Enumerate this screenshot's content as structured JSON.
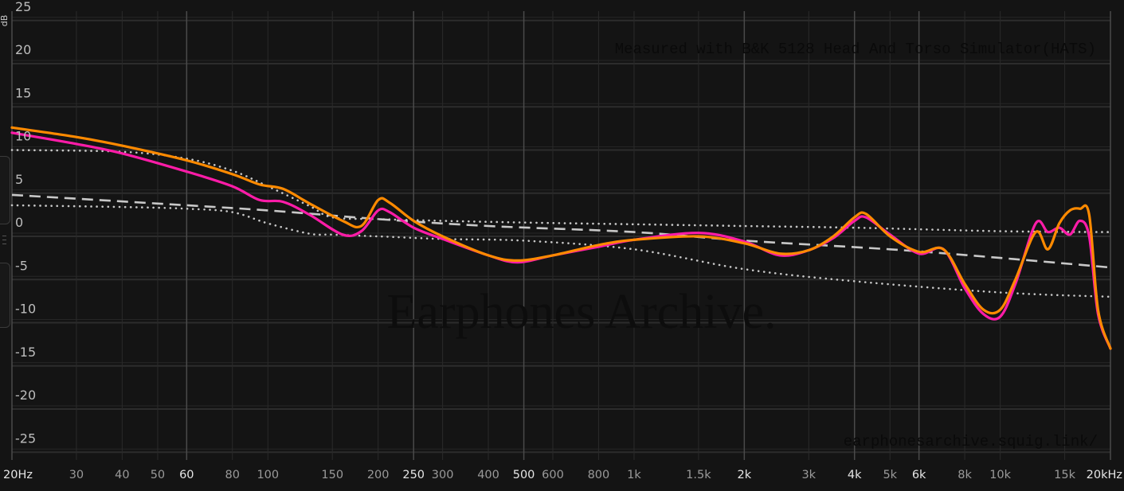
{
  "chart_data": {
    "type": "line",
    "title": "",
    "xlabel": "",
    "ylabel": "dB",
    "x_scale": "log",
    "xlim": [
      20,
      20000
    ],
    "ylim": [
      -27,
      27
    ],
    "grid": true,
    "y_ticks": [
      25,
      20,
      15,
      10,
      5,
      0,
      -5,
      -10,
      -15,
      -20,
      -25
    ],
    "y_tick_labels": [
      "25",
      "20",
      "15",
      "10",
      "5",
      "0",
      "-5",
      "-10",
      "-15",
      "-20",
      "-25"
    ],
    "x_ticks": [
      {
        "f": 20,
        "label": "20Hz",
        "major": true
      },
      {
        "f": 30,
        "label": "30",
        "major": false
      },
      {
        "f": 40,
        "label": "40",
        "major": false
      },
      {
        "f": 50,
        "label": "50",
        "major": false
      },
      {
        "f": 60,
        "label": "60",
        "major": true
      },
      {
        "f": 80,
        "label": "80",
        "major": false
      },
      {
        "f": 100,
        "label": "100",
        "major": false
      },
      {
        "f": 150,
        "label": "150",
        "major": false
      },
      {
        "f": 200,
        "label": "200",
        "major": false
      },
      {
        "f": 250,
        "label": "250",
        "major": true
      },
      {
        "f": 300,
        "label": "300",
        "major": false
      },
      {
        "f": 400,
        "label": "400",
        "major": false
      },
      {
        "f": 500,
        "label": "500",
        "major": true
      },
      {
        "f": 600,
        "label": "600",
        "major": false
      },
      {
        "f": 800,
        "label": "800",
        "major": false
      },
      {
        "f": 1000,
        "label": "1k",
        "major": false
      },
      {
        "f": 1500,
        "label": "1.5k",
        "major": false
      },
      {
        "f": 2000,
        "label": "2k",
        "major": true
      },
      {
        "f": 3000,
        "label": "3k",
        "major": false
      },
      {
        "f": 4000,
        "label": "4k",
        "major": true
      },
      {
        "f": 5000,
        "label": "5k",
        "major": false
      },
      {
        "f": 6000,
        "label": "6k",
        "major": true
      },
      {
        "f": 8000,
        "label": "8k",
        "major": false
      },
      {
        "f": 10000,
        "label": "10k",
        "major": false
      },
      {
        "f": 15000,
        "label": "15k",
        "major": false
      },
      {
        "f": 20000,
        "label": "20kHz",
        "major": true
      }
    ],
    "annotations": {
      "top": "Measured with B&K 5128 Head And Torso Simulator(HATS)",
      "watermark": "Earphones Archive.",
      "bottom": "earphonesarchive.squig.link/"
    },
    "series": [
      {
        "color": "#ff8a00",
        "style": "solid",
        "x": [
          20,
          30,
          40,
          60,
          80,
          95,
          110,
          130,
          160,
          180,
          200,
          215,
          250,
          300,
          400,
          480,
          600,
          800,
          1000,
          1500,
          2000,
          2500,
          3000,
          3500,
          4000,
          4300,
          5000,
          6000,
          7000,
          8000,
          9000,
          10000,
          11000,
          12500,
          13500,
          14500,
          15500,
          16500,
          17500,
          18500,
          20000
        ],
        "y": [
          12.6,
          11.5,
          10.5,
          8.8,
          7.2,
          6.0,
          5.5,
          3.8,
          1.8,
          1.2,
          4.2,
          3.9,
          1.8,
          0.0,
          -2.2,
          -2.8,
          -2.2,
          -1.0,
          -0.4,
          0.0,
          -0.8,
          -2.0,
          -1.6,
          0.0,
          2.2,
          2.6,
          0.0,
          -1.8,
          -1.5,
          -5.5,
          -8.5,
          -8.5,
          -5.0,
          0.5,
          -1.5,
          1.5,
          3.0,
          3.2,
          2.5,
          -8.5,
          -13.0
        ]
      },
      {
        "color": "#ff1ca8",
        "style": "solid",
        "x": [
          20,
          30,
          40,
          60,
          80,
          95,
          110,
          130,
          160,
          180,
          200,
          215,
          250,
          300,
          400,
          480,
          600,
          800,
          1000,
          1500,
          2000,
          2500,
          3000,
          3500,
          4000,
          4300,
          5000,
          6000,
          7000,
          8000,
          9000,
          10000,
          11000,
          12500,
          13500,
          14500,
          15500,
          16500,
          17500,
          18500,
          20000
        ],
        "y": [
          12.0,
          10.7,
          9.6,
          7.5,
          5.8,
          4.2,
          4.0,
          2.5,
          0.2,
          0.6,
          3.0,
          2.8,
          1.0,
          -0.3,
          -2.2,
          -3.0,
          -2.2,
          -1.2,
          -0.4,
          0.4,
          -0.6,
          -2.2,
          -1.6,
          -0.2,
          1.8,
          2.2,
          0.2,
          -2.0,
          -1.5,
          -6.0,
          -9.0,
          -9.3,
          -5.5,
          1.5,
          0.5,
          1.0,
          0.2,
          1.8,
          0.0,
          -9.0,
          -13.0
        ]
      },
      {
        "color": "#c8c8c8",
        "style": "dashed",
        "x": [
          20,
          50,
          100,
          200,
          400,
          1000,
          2000,
          5000,
          10000,
          20000
        ],
        "y": [
          4.8,
          3.8,
          3.0,
          2.0,
          1.2,
          0.5,
          -0.5,
          -1.5,
          -2.5,
          -3.6
        ]
      },
      {
        "color": "#c8c8c8",
        "style": "dotted",
        "x": [
          20,
          40,
          60,
          80,
          100,
          130,
          150,
          200,
          300,
          500,
          1000,
          2000,
          4000,
          10000,
          20000
        ],
        "y": [
          10.0,
          9.8,
          9.0,
          7.6,
          5.8,
          3.5,
          2.2,
          2.0,
          1.8,
          1.6,
          1.4,
          1.2,
          1.0,
          0.6,
          0.5
        ]
      },
      {
        "color": "#c8c8c8",
        "style": "dotted",
        "x": [
          20,
          40,
          60,
          80,
          100,
          130,
          150,
          200,
          300,
          500,
          1000,
          2000,
          4000,
          10000,
          20000
        ],
        "y": [
          3.6,
          3.4,
          3.2,
          2.8,
          1.5,
          0.3,
          0.2,
          0.0,
          -0.3,
          -0.5,
          -1.5,
          -3.8,
          -5.2,
          -6.5,
          -7.0
        ]
      }
    ]
  }
}
